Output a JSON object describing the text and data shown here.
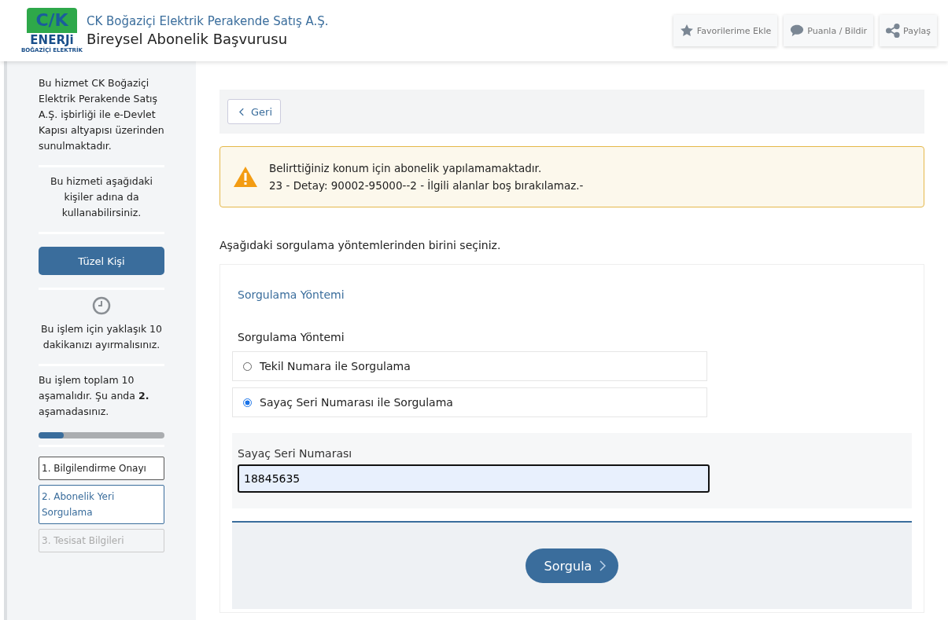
{
  "header": {
    "company": "CK Boğaziçi Elektrik Perakende Satış A.Ş.",
    "title": "Bireysel Abonelik Başvurusu",
    "logo": {
      "top": "C/K",
      "middle": "ENERJi",
      "bottom": "BOĞAZİÇİ ELEKTRİK"
    },
    "actions": [
      {
        "kind": "star",
        "label": "Favorilerime Ekle"
      },
      {
        "kind": "comment",
        "label": "Puanla / Bildir"
      },
      {
        "kind": "share",
        "label": "Paylaş"
      }
    ]
  },
  "sidebar": {
    "intro": "Bu hizmet CK Boğaziçi Elektrik Perakende Satış A.Ş. işbirliği ile e-Devlet Kapısı altyapısı üzerinden sunulmaktadır.",
    "on_behalf": "Bu hizmeti aşağıdaki kişiler adına da kullanabilirsiniz.",
    "on_behalf_button": "Tüzel Kişi",
    "duration": "Bu işlem için yaklaşık 10 dakikanızı ayırmalısınız.",
    "progress_text": "Bu işlem toplam 10 aşamalıdır. Şu anda **2.** aşamadasınız.",
    "progress": {
      "level": 0.2
    },
    "steps": [
      {
        "label": "1. Bilgilendirme Onayı",
        "completed": true,
        "selected": false
      },
      {
        "label": "2. Abonelik Yeri Sorgulama",
        "completed": false,
        "selected": true
      },
      {
        "label": "3. Tesisat Bilgileri",
        "completed": false,
        "selected": false
      }
    ]
  },
  "back_button": "Geri",
  "alert": {
    "lines": [
      "Belirttiğiniz konum için abonelik yapılamamaktadır.",
      "23 - Detay: 90002-95000--2 - İlgili alanlar boş bırakılamaz.-"
    ]
  },
  "instruction": "Aşağıdaki sorgulama yöntemlerinden birini seçiniz.",
  "form": {
    "section_title": "Sorgulama Yöntemi",
    "group_label": "Sorgulama Yöntemi",
    "options": [
      {
        "label": "Tekil Numara ile Sorgulama",
        "selected": false
      },
      {
        "label": "Sayaç Seri Numarası ile Sorgulama",
        "selected": true
      }
    ],
    "field": {
      "label": "Sayaç Seri Numarası",
      "value": "18845635"
    },
    "submit": "Sorgula"
  }
}
